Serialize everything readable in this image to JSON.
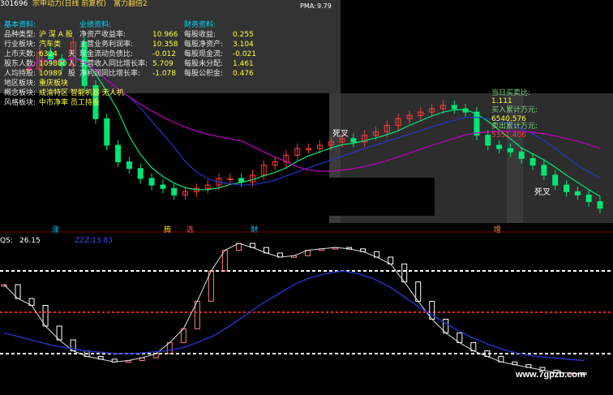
{
  "header": {
    "code": "301696",
    "name": "宗申动力(日线 前复权)",
    "indicator": "富力翻倍2",
    "pma_label": "PMA:",
    "pma_value": "9.79"
  },
  "basic": {
    "title": "基本资料:",
    "rows": [
      {
        "label": "品种类型:",
        "value": "沪 深 A 股"
      },
      {
        "label": "行业板块:",
        "value": "汽车类"
      },
      {
        "label": "上市天数:",
        "value": "6324",
        "unit": "天"
      },
      {
        "label": "股东人数:",
        "value": "109800",
        "unit": "人"
      },
      {
        "label": "人均持股:",
        "value": "10989",
        "unit": "股"
      },
      {
        "label": "地区板块:",
        "value": "重庆板块"
      },
      {
        "label": "概念板块:",
        "value": "成渝特区  智能机器  无人机"
      },
      {
        "label": "风格板块:",
        "value": "中市净率  员工持股"
      }
    ]
  },
  "perf": {
    "title": "业绩资料:",
    "rows": [
      {
        "label": "净资产收益率:",
        "value": "10.966"
      },
      {
        "label": "主营业务利润率:",
        "value": "10.358"
      },
      {
        "label": "现金流动负债比:",
        "value": "-0.012"
      },
      {
        "label": "主营收入同比增长率:",
        "value": "5.709"
      },
      {
        "label": "净利润同比增长率:",
        "value": "-1.078"
      }
    ]
  },
  "fin": {
    "title": "财务资料:",
    "rows": [
      {
        "label": "每股收益:",
        "value": "0.255"
      },
      {
        "label": "每股净资产:",
        "value": "3.104"
      },
      {
        "label": "每股现金流:",
        "value": "-0.021"
      },
      {
        "label": "每股未分配:",
        "value": "1.461"
      },
      {
        "label": "每股公积金:",
        "value": "0.476"
      }
    ]
  },
  "right_panel": {
    "l1": "当日买卖比:",
    "v1": "1.111",
    "l2": "买入累计万元:",
    "v2": "6540.576",
    "l3": "卖出累计万元:",
    "v3": "5351.406"
  },
  "signals": [
    {
      "text": "死叉",
      "color": "#ffffff"
    },
    {
      "text": "死叉",
      "color": "#ffffff"
    }
  ],
  "markers": [
    {
      "text": "涨",
      "color": "#00c8ff"
    },
    {
      "text": "腾",
      "color": "#ffd700"
    },
    {
      "text": "选",
      "color": "#ff5050"
    },
    {
      "text": "财",
      "color": "#00c8ff"
    },
    {
      "text": "增",
      "color": "#ff9040"
    }
  ],
  "sub_panel": {
    "label1": "QS:",
    "value1": "26.15",
    "label2": "ZZZ:",
    "value2": "13.83"
  },
  "watermark": "www.7gpzb.com",
  "colors": {
    "up": "#ff3c3c",
    "down": "#00e676",
    "ma_blue": "#2535c8",
    "ma_purple": "#c000c0",
    "label_cyan": "#00d8ff",
    "value_yellow": "#ffff3c"
  },
  "chart_data": {
    "type": "candlestick",
    "price_series": [
      10.9,
      11.4,
      11.2,
      11.0,
      11.7,
      10.4,
      9.4,
      8.6,
      8.1,
      7.9,
      7.6,
      7.4,
      7.3,
      7.1,
      7.2,
      7.3,
      7.4,
      7.6,
      7.6,
      7.5,
      7.7,
      8.0,
      8.1,
      8.3,
      8.5,
      8.5,
      8.6,
      8.7,
      8.8,
      8.7,
      8.9,
      9.0,
      9.2,
      9.4,
      9.5,
      9.6,
      9.7,
      9.8,
      9.7,
      9.6,
      8.9,
      8.6,
      8.5,
      8.4,
      8.2,
      8.0,
      7.7,
      7.4,
      7.2,
      7.1,
      6.9,
      6.7
    ],
    "qs_series": [
      70,
      60,
      55,
      40,
      30,
      22,
      18,
      16,
      14,
      15,
      17,
      20,
      28,
      38,
      58,
      80,
      95,
      100,
      97,
      93,
      90,
      91,
      95,
      96,
      97,
      96,
      94,
      90,
      85,
      72,
      58,
      45,
      35,
      28,
      22,
      18,
      14,
      12,
      10,
      8,
      6,
      6,
      5
    ],
    "zzz_series": [
      35,
      32,
      29,
      26,
      24,
      22,
      21,
      20,
      20,
      21,
      22,
      24,
      28,
      33,
      40,
      48,
      56,
      63,
      70,
      75,
      78,
      80,
      78,
      74,
      68,
      60,
      52,
      45,
      38,
      32,
      27,
      23,
      20,
      18,
      17,
      16,
      15
    ],
    "qs_hlines": [
      80,
      50,
      20
    ],
    "qs_current": 26.15,
    "zzz_current": 13.83
  }
}
